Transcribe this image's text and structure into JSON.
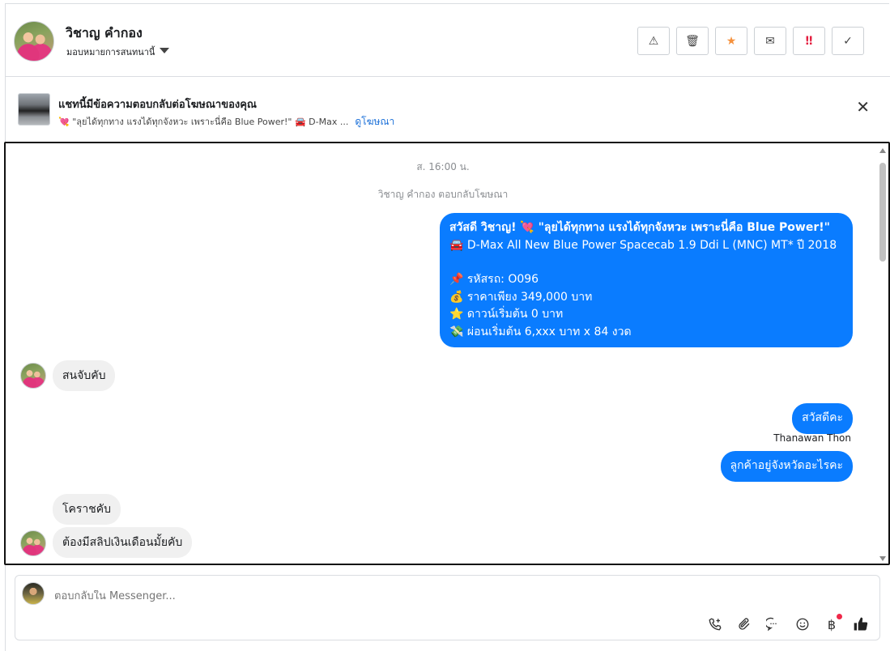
{
  "header": {
    "name": "วิชาญ คำกอง",
    "assign_label": "มอบหมายการสนทนานี้",
    "actions": [
      {
        "name": "report-button",
        "icon": "warning-icon",
        "glyph": "⚠",
        "color": "#333333"
      },
      {
        "name": "delete-button",
        "icon": "trash-icon",
        "glyph": "🗑",
        "color": "#333333"
      },
      {
        "name": "star-button",
        "icon": "star-icon",
        "glyph": "★",
        "color": "#f5923e"
      },
      {
        "name": "mark-unread-button",
        "icon": "envelope-icon",
        "glyph": "✉",
        "color": "#333333"
      },
      {
        "name": "follow-up-button",
        "icon": "double-exclamation-icon",
        "glyph": "‼",
        "color": "#e41e3f"
      },
      {
        "name": "mark-done-button",
        "icon": "checkmark-icon",
        "glyph": "✓",
        "color": "#333333"
      }
    ]
  },
  "banner": {
    "title": "แชทนี้มีข้อความตอบกลับต่อโฆษณาของคุณ",
    "ad_text": "💘 \"ลุยได้ทุกทาง แรงได้ทุกจังหวะ เพราะนี่คือ Blue Power!\" 🚘 D-Max ...",
    "link": "ดูโฆษณา"
  },
  "chat": {
    "timestamp": "ส. 16:00 น.",
    "system_note": "วิชาญ คำกอง ตอบกลับโฆษณา",
    "ad_message": {
      "line1": "สวัสดี วิชาญ! 💘 \"ลุยได้ทุกทาง แรงได้ทุกจังหวะ  เพราะนี่คือ Blue Power!\"",
      "line2": "🚘 D-Max All New Blue Power Spacecab 1.9 Ddi L (MNC) MT* ปี 2018",
      "line3": "📌 รหัสรถ: O096",
      "line4": "💰 ราคาเพียง 349,000 บาท",
      "line5": "⭐ ดาวน์เริ่มต้น 0 บาท",
      "line6": "💸 ผ่อนเริ่มต้น 6,xxx บาท x 84 งวด"
    },
    "in_1": "สนจับคับ",
    "out_1": "สวัสดีคะ",
    "sender_1": "Thanawan Thon",
    "out_2": "ลูกค้าอยู่จังหวัดอะไรคะ",
    "in_2": "โคราชคับ",
    "in_3": "ต้องมีสลิปเงินเดือนมั้ยคับ"
  },
  "composer": {
    "placeholder": "ตอบกลับใน Messenger...",
    "tools": [
      {
        "name": "call-button",
        "icon": "phone-plus-icon",
        "glyph": "📞"
      },
      {
        "name": "attach-button",
        "icon": "paperclip-icon",
        "glyph": "📎"
      },
      {
        "name": "saved-reply-button",
        "icon": "speech-bubble-icon",
        "glyph": "💬"
      },
      {
        "name": "emoji-button",
        "icon": "smiley-icon",
        "glyph": "☺"
      },
      {
        "name": "payment-button",
        "icon": "baht-icon",
        "glyph": "฿"
      },
      {
        "name": "like-button",
        "icon": "thumbs-up-icon",
        "glyph": "👍"
      }
    ]
  }
}
